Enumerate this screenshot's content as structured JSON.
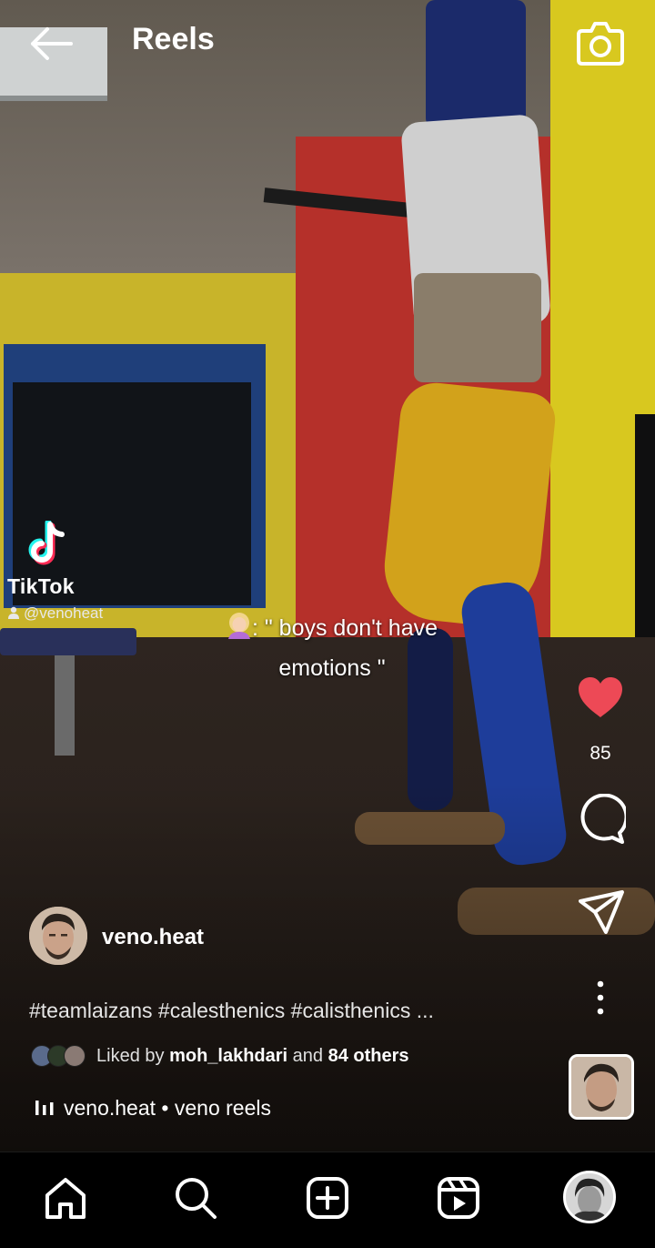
{
  "header": {
    "title": "Reels"
  },
  "watermark": {
    "brand": "TikTok",
    "handle": "@venoheat"
  },
  "caption": {
    "text": ": \" boys don't have emotions \""
  },
  "actions": {
    "like_count": "85"
  },
  "author": {
    "username": "veno.heat"
  },
  "post": {
    "hashtags": "#teamlaizans #calesthenics #calisthenics ..."
  },
  "likes": {
    "prefix": "Liked by",
    "user": "moh_lakhdari",
    "middle": "and",
    "others": "84 others"
  },
  "audio": {
    "label": "veno.heat • veno reels"
  },
  "colors": {
    "like": "#ed4956",
    "background": "#000000",
    "text": "#ffffff"
  },
  "icons": {
    "back": "arrow-left-icon",
    "camera": "camera-icon",
    "like": "heart-icon",
    "comment": "comment-icon",
    "share": "paper-plane-icon",
    "more": "more-vertical-icon",
    "nav": [
      "home-icon",
      "search-icon",
      "create-icon",
      "reels-icon",
      "profile-avatar"
    ]
  }
}
